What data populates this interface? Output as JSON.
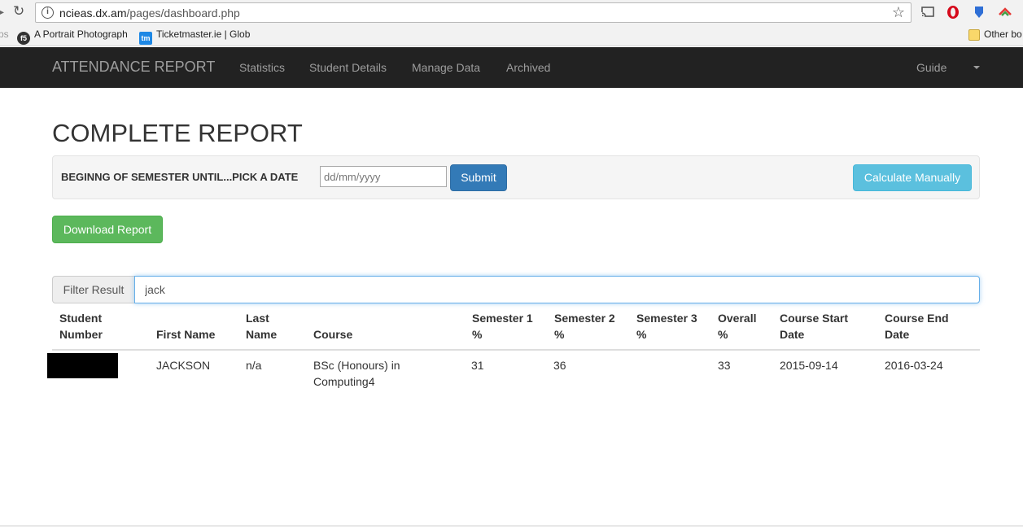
{
  "browser": {
    "url_host": "ncieas.dx.am",
    "url_path": "/pages/dashboard.php",
    "bookmarks": [
      {
        "label": "ps"
      },
      {
        "label": "A Portrait Photograph"
      },
      {
        "label": "Ticketmaster.ie | Glob"
      },
      {
        "label": "Other bo"
      }
    ]
  },
  "navbar": {
    "brand": "ATTENDANCE REPORT",
    "links": [
      "Statistics",
      "Student Details",
      "Manage Data",
      "Archived"
    ],
    "guide": "Guide"
  },
  "main": {
    "title": "COMPLETE REPORT",
    "date_label": "BEGINNG OF SEMESTER UNTIL...PICK A DATE",
    "date_placeholder": "dd/mm/yyyy",
    "submit": "Submit",
    "calculate": "Calculate Manually",
    "download": "Download Report",
    "filter_label": "Filter Result",
    "filter_value": "jack"
  },
  "table": {
    "headers": [
      [
        "Student",
        "Number"
      ],
      [
        "First Name"
      ],
      [
        "Last",
        "Name"
      ],
      [
        "Course"
      ],
      [
        "Semester 1",
        "%"
      ],
      [
        "Semester 2",
        "%"
      ],
      [
        "Semester 3",
        "%"
      ],
      [
        "Overall",
        "%"
      ],
      [
        "Course Start",
        "Date"
      ],
      [
        "Course End",
        "Date"
      ]
    ],
    "rows": [
      {
        "student_number": "",
        "first_name": "JACKSON",
        "last_name": "n/a",
        "course": [
          "BSc (Honours) in",
          "Computing4"
        ],
        "sem1": "31",
        "sem2": "36",
        "sem3": "",
        "overall": "33",
        "start": "2015-09-14",
        "end": "2016-03-24"
      }
    ]
  },
  "colors": {
    "navbar": "#222222",
    "primary": "#337ab7",
    "info": "#5bc0de",
    "success": "#5cb85c"
  }
}
